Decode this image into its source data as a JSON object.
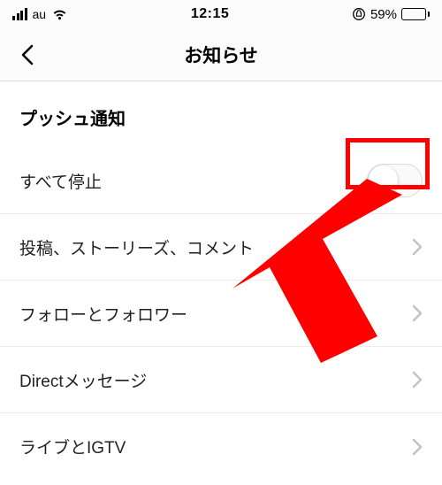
{
  "status": {
    "carrier": "au",
    "time": "12:15",
    "battery_pct": "59%"
  },
  "nav": {
    "title": "お知らせ"
  },
  "section": {
    "header": "プッシュ通知"
  },
  "rows": {
    "pause_all": "すべて停止",
    "posts": "投稿、ストーリーズ、コメント",
    "follow": "フォローとフォロワー",
    "direct": "Directメッセージ",
    "live": "ライブとIGTV"
  }
}
